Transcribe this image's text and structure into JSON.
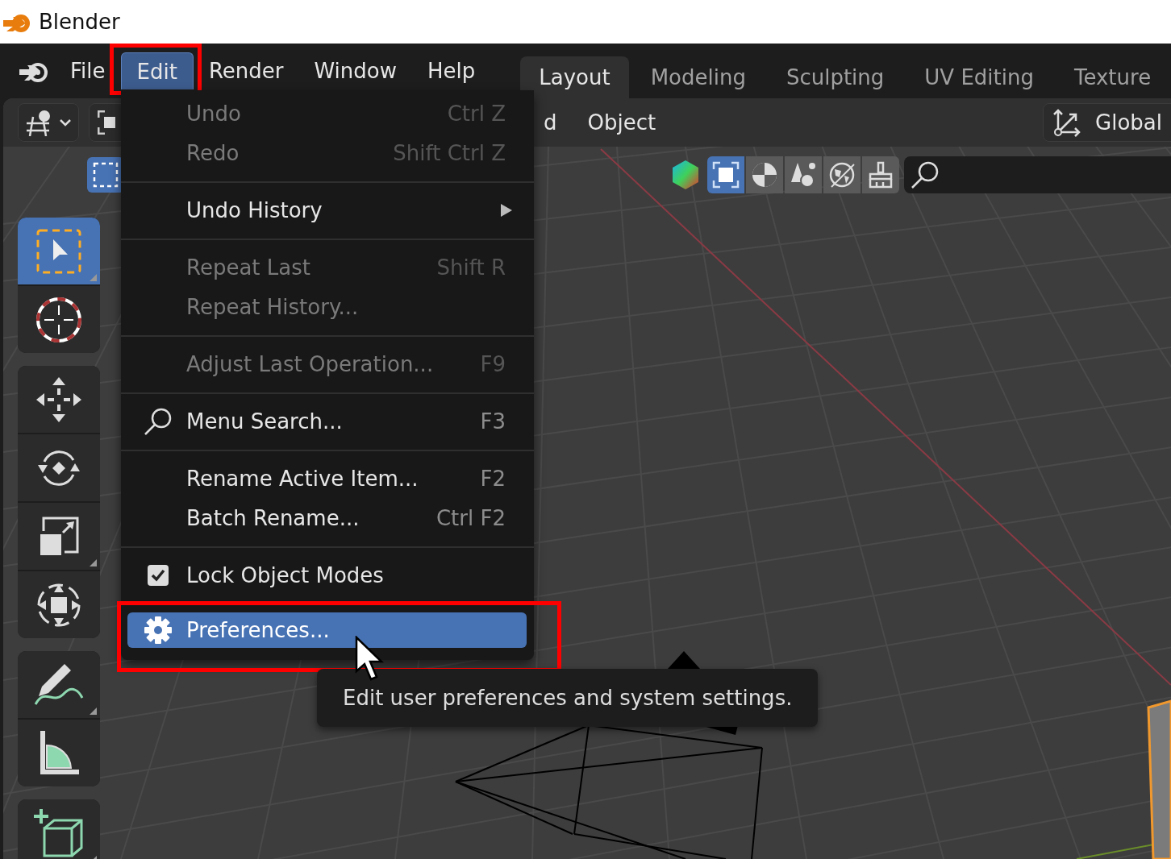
{
  "title_bar": {
    "title": "Blender"
  },
  "menu_bar": {
    "menus": [
      {
        "label": "File",
        "selected": false
      },
      {
        "label": "Edit",
        "selected": true
      },
      {
        "label": "Render",
        "selected": false
      },
      {
        "label": "Window",
        "selected": false
      },
      {
        "label": "Help",
        "selected": false
      }
    ]
  },
  "workspace_tabs": [
    {
      "label": "Layout",
      "selected": true
    },
    {
      "label": "Modeling",
      "selected": false
    },
    {
      "label": "Sculpting",
      "selected": false
    },
    {
      "label": "UV Editing",
      "selected": false
    },
    {
      "label": "Texture",
      "selected": false
    }
  ],
  "viewport_header": {
    "menus": [
      "d",
      "Object"
    ],
    "orientation": "Global"
  },
  "shading_buttons": [
    {
      "kind": "frame",
      "selected": true
    },
    {
      "kind": "half",
      "selected": false
    },
    {
      "kind": "shapes",
      "selected": false
    },
    {
      "kind": "globe",
      "selected": false
    },
    {
      "kind": "brush",
      "selected": false
    }
  ],
  "toolbar_groups": [
    {
      "tools": [
        {
          "kind": "select_box",
          "selected": true,
          "has_variants": true
        },
        {
          "kind": "cursor",
          "selected": false,
          "has_variants": false
        }
      ]
    },
    {
      "tools": [
        {
          "kind": "move",
          "selected": false,
          "has_variants": false
        },
        {
          "kind": "rotate",
          "selected": false,
          "has_variants": false
        },
        {
          "kind": "scale",
          "selected": false,
          "has_variants": true
        },
        {
          "kind": "transform",
          "selected": false,
          "has_variants": false
        }
      ]
    },
    {
      "tools": [
        {
          "kind": "annotate",
          "selected": false,
          "has_variants": true
        },
        {
          "kind": "measure",
          "selected": false,
          "has_variants": false
        }
      ]
    },
    {
      "tools": [
        {
          "kind": "add_cube",
          "selected": false,
          "has_variants": true
        }
      ]
    }
  ],
  "edit_menu": {
    "sections": [
      {
        "items": [
          {
            "kind": "action",
            "label": "Undo",
            "shortcut": "Ctrl Z",
            "disabled": true,
            "selected": false
          },
          {
            "kind": "action",
            "label": "Redo",
            "shortcut": "Shift Ctrl Z",
            "disabled": true,
            "selected": false
          }
        ]
      },
      {
        "items": [
          {
            "kind": "submenu",
            "label": "Undo History",
            "disabled": false,
            "selected": false
          }
        ]
      },
      {
        "items": [
          {
            "kind": "action",
            "label": "Repeat Last",
            "shortcut": "Shift R",
            "disabled": true,
            "selected": false
          },
          {
            "kind": "action",
            "label": "Repeat History...",
            "disabled": true,
            "selected": false
          }
        ]
      },
      {
        "items": [
          {
            "kind": "action",
            "label": "Adjust Last Operation...",
            "shortcut": "F9",
            "disabled": true,
            "selected": false
          }
        ]
      },
      {
        "items": [
          {
            "kind": "search",
            "label": "Menu Search...",
            "shortcut": "F3",
            "disabled": false,
            "selected": false
          }
        ]
      },
      {
        "items": [
          {
            "kind": "action",
            "label": "Rename Active Item...",
            "shortcut": "F2",
            "disabled": false,
            "selected": false
          },
          {
            "kind": "action",
            "label": "Batch Rename...",
            "shortcut": "Ctrl F2",
            "disabled": false,
            "selected": false
          }
        ]
      },
      {
        "items": [
          {
            "kind": "checkbox",
            "label": "Lock Object Modes",
            "checked": true,
            "disabled": false,
            "selected": false
          }
        ]
      },
      {
        "items": [
          {
            "kind": "settings",
            "label": "Preferences...",
            "disabled": false,
            "selected": true
          }
        ]
      }
    ]
  },
  "tooltip": "Edit user preferences and system settings."
}
